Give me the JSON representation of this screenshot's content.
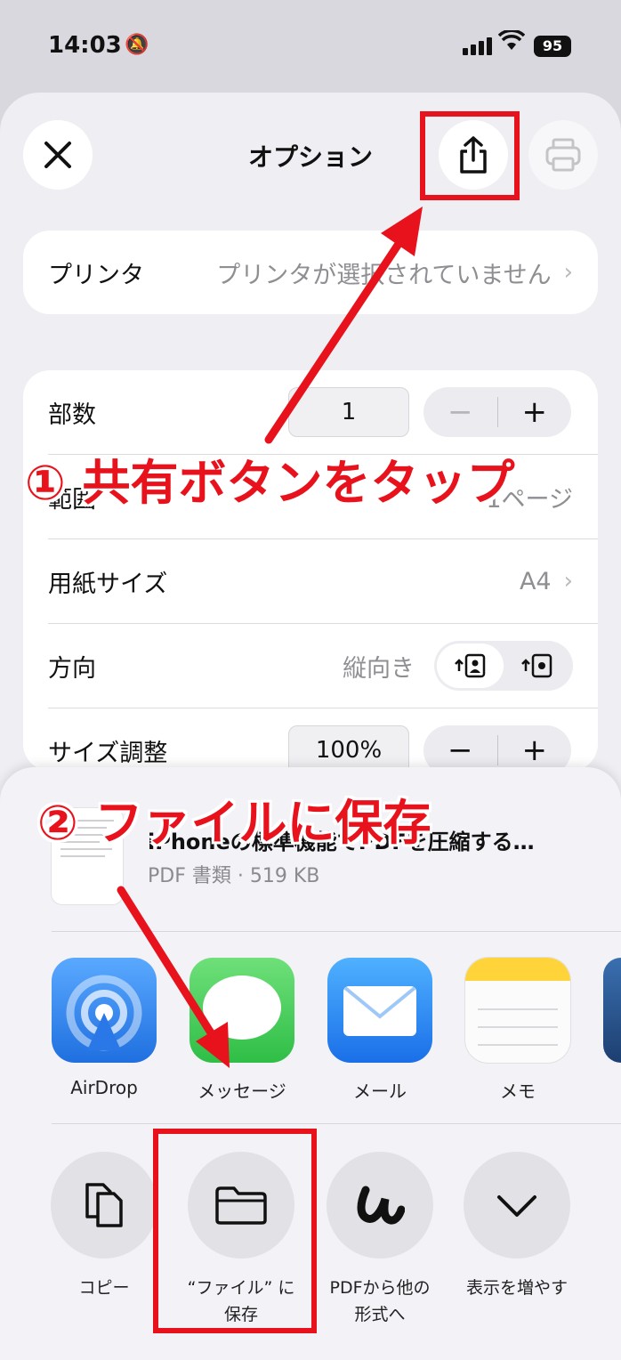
{
  "status": {
    "time": "14:03",
    "battery": "95"
  },
  "header": {
    "title": "オプション"
  },
  "printer": {
    "label": "プリンタ",
    "value": "プリンタが選択されていません"
  },
  "copies": {
    "label": "部数",
    "value": "1",
    "minus": "−",
    "plus": "+"
  },
  "range": {
    "label": "範囲",
    "value": "1ページ"
  },
  "paper": {
    "label": "用紙サイズ",
    "value": "A4"
  },
  "orientation": {
    "label": "方向",
    "value": "縦向き"
  },
  "scale": {
    "label": "サイズ調整",
    "value": "100%",
    "minus": "−",
    "plus": "+"
  },
  "document": {
    "title": "iPhoneの標準機能でPDFを圧縮する…",
    "subtitle": "PDF 書類 · 519 KB"
  },
  "apps": [
    {
      "label": "AirDrop"
    },
    {
      "label": "メッセージ"
    },
    {
      "label": "メール"
    },
    {
      "label": "メモ"
    }
  ],
  "actions": [
    {
      "label": "コピー"
    },
    {
      "label": "“ファイル” に\n保存"
    },
    {
      "label": "PDFから他の\n形式へ"
    },
    {
      "label": "表示を増やす"
    }
  ],
  "annotations": {
    "step1": "① 共有ボタンをタップ",
    "step2": "② ファイルに保存",
    "color": "#e8121c"
  }
}
